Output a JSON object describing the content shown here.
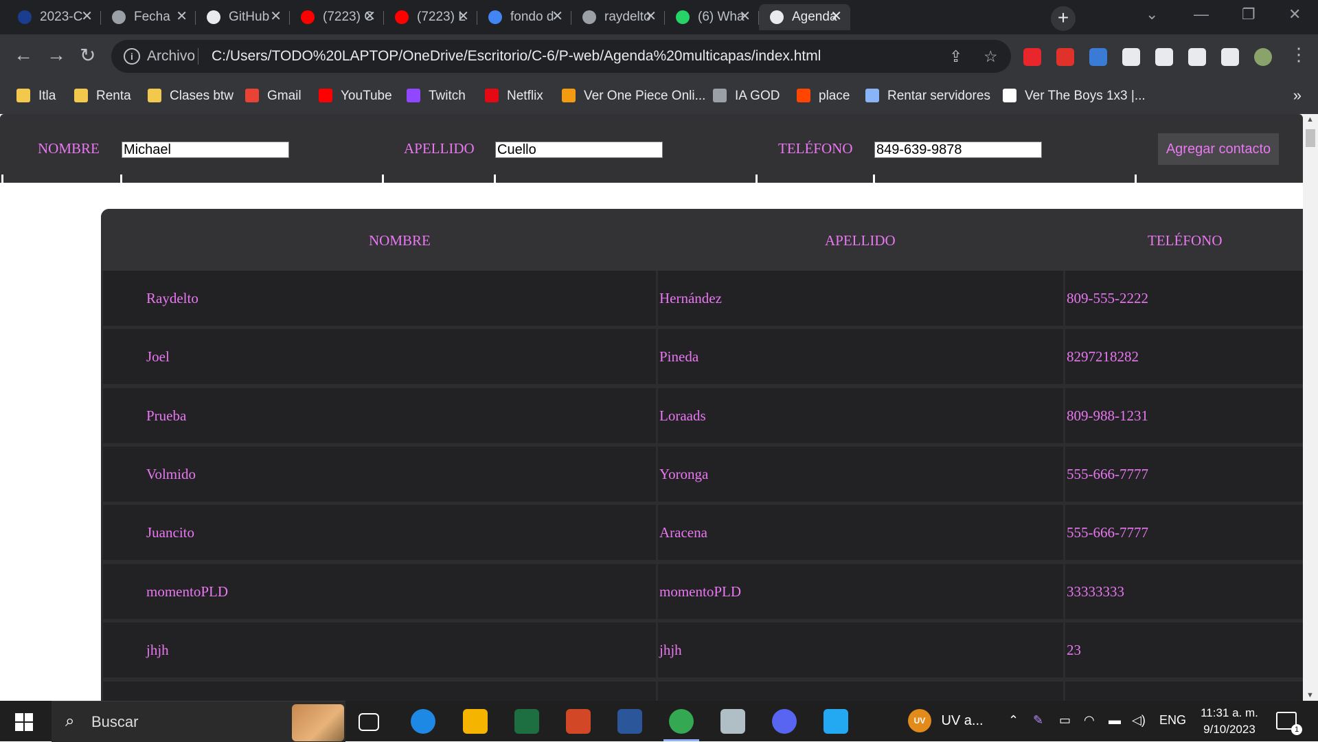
{
  "browser": {
    "tabs": [
      {
        "title": "2023-C",
        "favicon": "itla-icon",
        "color": "#1a3d8f"
      },
      {
        "title": "Fecha",
        "favicon": "globe-icon",
        "color": "#9aa0a6"
      },
      {
        "title": "GitHub",
        "favicon": "github-icon",
        "color": "#e8eaed"
      },
      {
        "title": "(7223) C",
        "favicon": "youtube-icon",
        "color": "#ff0000"
      },
      {
        "title": "(7223) L",
        "favicon": "youtube-icon",
        "color": "#ff0000"
      },
      {
        "title": "fondo d",
        "favicon": "google-icon",
        "color": "#4285f4"
      },
      {
        "title": "raydelto",
        "favicon": "globe-icon",
        "color": "#9aa0a6"
      },
      {
        "title": "(6) Wha",
        "favicon": "whatsapp-icon",
        "color": "#25d366"
      },
      {
        "title": "Agenda",
        "favicon": "home-icon",
        "color": "#e8eaed",
        "active": true
      }
    ],
    "new_tab_symbol": "+",
    "close_symbol": "✕",
    "window_controls": [
      "⌄",
      "—",
      "❐",
      "✕"
    ],
    "nav": {
      "back": "←",
      "forward": "→",
      "reload": "↻"
    },
    "address": {
      "scheme_label": "Archivo",
      "url": "C:/Users/TODO%20LAPTOP/OneDrive/Escritorio/C-6/P-web/Agenda%20multicapas/index.html",
      "share_icon": "⇪",
      "star_icon": "☆"
    },
    "extensions": [
      {
        "name": "adblock-icon",
        "color": "#e8262c"
      },
      {
        "name": "image-extension-icon",
        "color": "#e0322a"
      },
      {
        "name": "color-picker-icon",
        "color": "#3a7bd5"
      },
      {
        "name": "puzzle-icon",
        "color": "#e8eaed"
      },
      {
        "name": "media-queue-icon",
        "color": "#e8eaed"
      },
      {
        "name": "download-icon",
        "color": "#e8eaed"
      },
      {
        "name": "side-panel-icon",
        "color": "#e8eaed"
      },
      {
        "name": "profile-avatar",
        "color": "#8aa36b"
      }
    ],
    "menu_symbol": "⋮",
    "bookmarks": [
      {
        "label": "Itla",
        "icon": "folder-icon",
        "color": "#f2c94c"
      },
      {
        "label": "Renta",
        "icon": "folder-icon",
        "color": "#f2c94c"
      },
      {
        "label": "Clases btw",
        "icon": "folder-icon",
        "color": "#f2c94c"
      },
      {
        "label": "Gmail",
        "icon": "gmail-icon",
        "color": "#ea4335"
      },
      {
        "label": "YouTube",
        "icon": "youtube-icon",
        "color": "#ff0000"
      },
      {
        "label": "Twitch",
        "icon": "twitch-icon",
        "color": "#9146ff"
      },
      {
        "label": "Netflix",
        "icon": "netflix-icon",
        "color": "#e50914"
      },
      {
        "label": "Ver One Piece Onli...",
        "icon": "animeflv-icon",
        "color": "#f39c12"
      },
      {
        "label": "IA GOD",
        "icon": "openai-icon",
        "color": "#9aa0a6"
      },
      {
        "label": "place",
        "icon": "reddit-icon",
        "color": "#ff4500"
      },
      {
        "label": "Rentar servidores",
        "icon": "sparkle-icon",
        "color": "#8ab4f8"
      },
      {
        "label": "Ver The Boys 1x3 |...",
        "icon": "p-logo-icon",
        "color": "#ffffff"
      }
    ],
    "bookmarks_more": "»"
  },
  "form": {
    "nombre_label": "NOMBRE",
    "nombre_value": "Michael",
    "apellido_label": "APELLIDO",
    "apellido_value": "Cuello",
    "telefono_label": "TELÉFONO",
    "telefono_value": "849-639-9878",
    "submit_label": "Agregar contacto"
  },
  "table": {
    "headers": [
      "NOMBRE",
      "APELLIDO",
      "TELÉFONO"
    ],
    "rows": [
      [
        "Raydelto",
        "Hernández",
        "809-555-2222"
      ],
      [
        "Joel",
        "Pineda",
        "8297218282"
      ],
      [
        "Prueba",
        "Loraads",
        "809-988-1231"
      ],
      [
        "Volmido",
        "Yoronga",
        "555-666-7777"
      ],
      [
        "Juancito",
        "Aracena",
        "555-666-7777"
      ],
      [
        "momentoPLD",
        "momentoPLD",
        "33333333"
      ],
      [
        "jhjh",
        "jhjh",
        "23"
      ]
    ]
  },
  "taskbar": {
    "search_placeholder": "Buscar",
    "apps": [
      {
        "name": "task-view-icon",
        "color": "#1f1f1f"
      },
      {
        "name": "edge-icon",
        "color": "#1e88e5"
      },
      {
        "name": "file-explorer-icon",
        "color": "#f4b400"
      },
      {
        "name": "excel-icon",
        "color": "#1d6f42"
      },
      {
        "name": "powerpoint-icon",
        "color": "#d24726"
      },
      {
        "name": "word-icon",
        "color": "#2b579a"
      },
      {
        "name": "chrome-icon",
        "color": "#34a853",
        "active": true
      },
      {
        "name": "photo-app-icon",
        "color": "#b0bec5"
      },
      {
        "name": "discord-icon",
        "color": "#5865f2"
      },
      {
        "name": "vscode-icon",
        "color": "#23a9f2"
      }
    ],
    "pinned_app_label": "UV a...",
    "pinned_app_badge": "UV",
    "tray_language": "ENG",
    "time": "11:31 a. m.",
    "date": "9/10/2023",
    "notification_count": "1"
  }
}
